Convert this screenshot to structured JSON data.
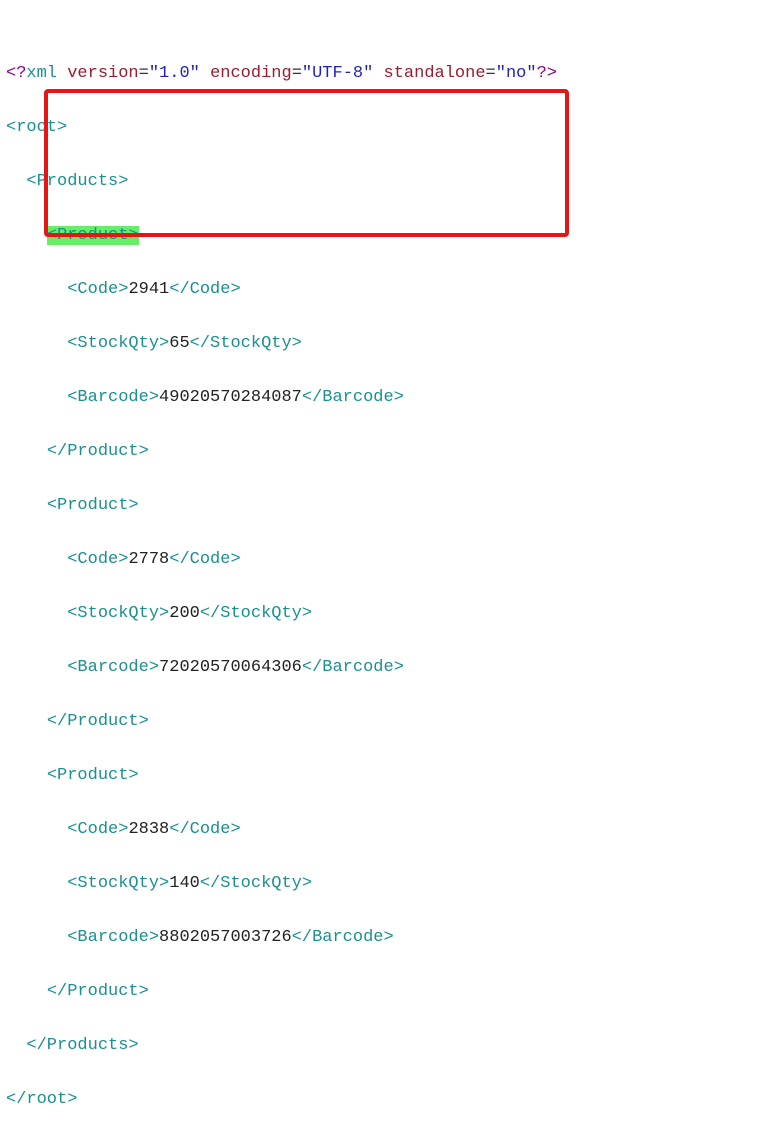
{
  "xml_decl": {
    "open": "<?",
    "name": "xml",
    "attrs": [
      {
        "name": "version",
        "value": "\"1.0\""
      },
      {
        "name": "encoding",
        "value": "\"UTF-8\""
      },
      {
        "name": "standalone",
        "value": "\"no\""
      }
    ],
    "close": "?>"
  },
  "root_open": "<root>",
  "root_close": "</root>",
  "products_open": "<Products>",
  "products_close": "</Products>",
  "products": [
    {
      "open": "<Product>",
      "close": "</Product>",
      "highlighted": true,
      "code_open": "<Code>",
      "code_val": "2941",
      "code_close": "</Code>",
      "qty_open": "<StockQty>",
      "qty_val": "65",
      "qty_close": "</StockQty>",
      "barcode_open": "<Barcode>",
      "barcode_val": "49020570284087",
      "barcode_close": "</Barcode>"
    },
    {
      "open": "<Product>",
      "close": "</Product>",
      "highlighted": false,
      "code_open": "<Code>",
      "code_val": "2778",
      "code_close": "</Code>",
      "qty_open": "<StockQty>",
      "qty_val": "200",
      "qty_close": "</StockQty>",
      "barcode_open": "<Barcode>",
      "barcode_val": "72020570064306",
      "barcode_close": "</Barcode>"
    },
    {
      "open": "<Product>",
      "close": "</Product>",
      "highlighted": false,
      "code_open": "<Code>",
      "code_val": "2838",
      "code_close": "</Code>",
      "qty_open": "<StockQty>",
      "qty_val": "140",
      "qty_close": "</StockQty>",
      "barcode_open": "<Barcode>",
      "barcode_val": "8802057003726",
      "barcode_close": "</Barcode>"
    }
  ],
  "red_box": {
    "top_line": 3,
    "bottom_line": 7
  }
}
